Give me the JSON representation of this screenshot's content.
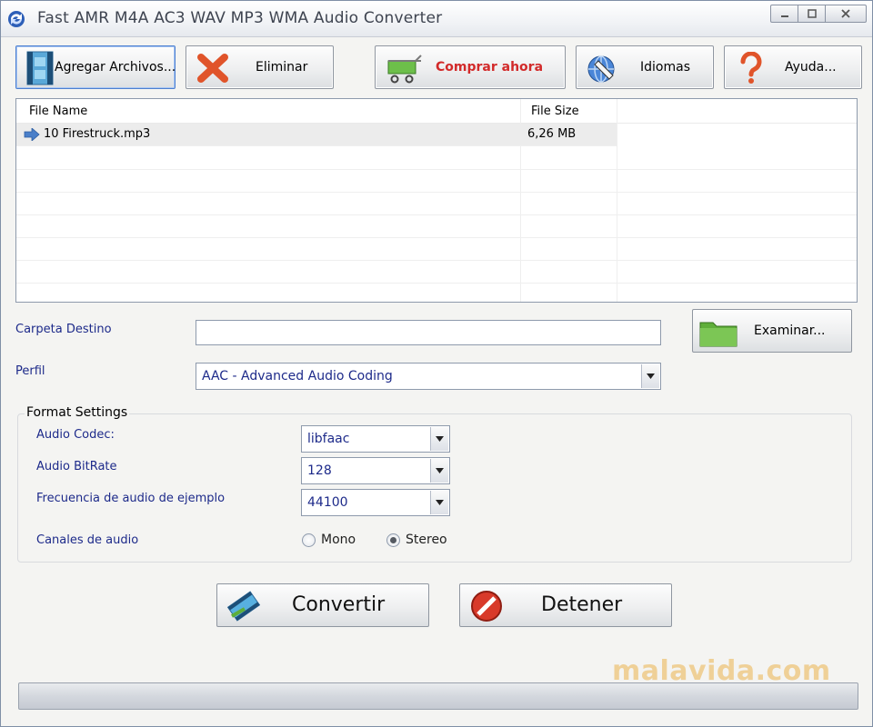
{
  "window": {
    "title": "Fast AMR M4A AC3 WAV MP3 WMA Audio Converter"
  },
  "toolbar": {
    "add_files_label": "Agregar Archivos...",
    "remove_label": "Eliminar",
    "buy_now_label": "Comprar ahora",
    "languages_label": "Idiomas",
    "help_label": "Ayuda..."
  },
  "file_list": {
    "columns": [
      "File Name",
      "File Size"
    ],
    "rows": [
      {
        "name": "10 Firestruck.mp3",
        "size": "6,26 MB"
      }
    ]
  },
  "form": {
    "dest_folder_label": "Carpeta Destino",
    "dest_folder_value": "",
    "browse_label": "Examinar...",
    "profile_label": "Perfil",
    "profile_value": "AAC - Advanced Audio Coding"
  },
  "format_settings": {
    "title": "Format Settings",
    "audio_codec_label": "Audio Codec:",
    "audio_codec_value": "libfaac",
    "audio_bitrate_label": "Audio BitRate",
    "audio_bitrate_value": "128",
    "sample_rate_label": "Frecuencia de audio de ejemplo",
    "sample_rate_value": "44100",
    "channels_label": "Canales de audio",
    "channel_options": [
      "Mono",
      "Stereo"
    ],
    "channel_selected": "Stereo"
  },
  "actions": {
    "convert_label": "Convertir",
    "stop_label": "Detener"
  },
  "progress": {
    "fraction": 0
  },
  "watermark": "malavida.com",
  "colors": {
    "label_blue": "#1d2a8a",
    "buy_red": "#d22a2a"
  }
}
